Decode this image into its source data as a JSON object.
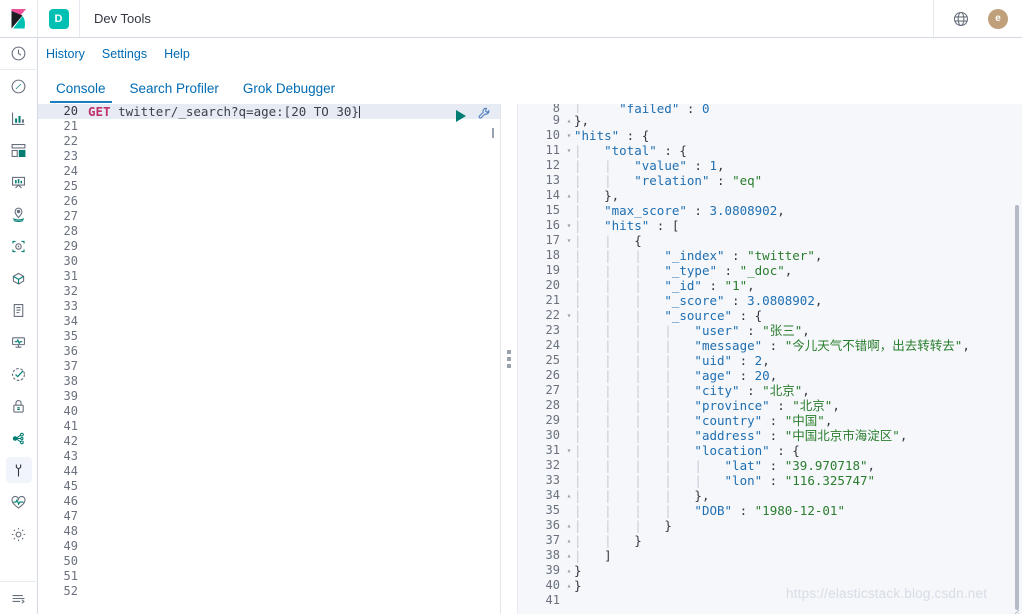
{
  "header": {
    "logo_icon": "kibana-logo-icon",
    "app_badge": "D",
    "title": "Dev Tools",
    "globe_icon": "globe-help-icon",
    "avatar_initial": "e"
  },
  "rail": {
    "items": [
      {
        "icon": "recently-viewed-clock-icon",
        "name": "recently-viewed"
      },
      {
        "icon": "discover-compass-icon",
        "name": "discover"
      },
      {
        "icon": "visualize-chart-icon",
        "name": "visualize"
      },
      {
        "icon": "dashboard-panels-icon",
        "name": "dashboard"
      },
      {
        "icon": "canvas-easel-icon",
        "name": "canvas"
      },
      {
        "icon": "maps-pin-icon",
        "name": "maps"
      },
      {
        "icon": "machine-learning-nodes-icon",
        "name": "machine-learning"
      },
      {
        "icon": "infrastructure-cube-icon",
        "name": "infrastructure"
      },
      {
        "icon": "logs-scroll-icon",
        "name": "logs"
      },
      {
        "icon": "apm-monitor-icon",
        "name": "apm"
      },
      {
        "icon": "uptime-check-icon",
        "name": "uptime"
      },
      {
        "icon": "siem-lock-icon",
        "name": "siem"
      },
      {
        "icon": "graph-network-icon",
        "name": "graph"
      },
      {
        "icon": "dev-tools-wrench-icon",
        "name": "dev-tools",
        "active": true
      },
      {
        "icon": "monitoring-heartbeat-icon",
        "name": "monitoring"
      },
      {
        "icon": "management-gear-icon",
        "name": "management"
      },
      {
        "icon": "collapse-nav-icon",
        "name": "collapse-nav"
      }
    ]
  },
  "subnav": {
    "links": [
      {
        "label": "History",
        "name": "history-link"
      },
      {
        "label": "Settings",
        "name": "settings-link"
      },
      {
        "label": "Help",
        "name": "help-link"
      }
    ]
  },
  "tabs": [
    {
      "label": "Console",
      "name": "tab-console",
      "active": true
    },
    {
      "label": "Search Profiler",
      "name": "tab-search-profiler",
      "active": false
    },
    {
      "label": "Grok Debugger",
      "name": "tab-grok-debugger",
      "active": false
    }
  ],
  "editor": {
    "first_line_number": 20,
    "last_line_number": 52,
    "method": "GET",
    "path": "twitter/_search?q=age:[20 TO 30}",
    "run_icon": "play-run-icon",
    "wrench_icon": "wrench-icon"
  },
  "response": {
    "lines": [
      {
        "n": "8",
        "fold": "",
        "text": "|     \"failed\" : 0",
        "partial": true
      },
      {
        "n": "9",
        "fold": "▴",
        "text": "},"
      },
      {
        "n": "10",
        "fold": "▾",
        "text": "\"hits\" : {"
      },
      {
        "n": "11",
        "fold": "▾",
        "text": "|   \"total\" : {"
      },
      {
        "n": "12",
        "fold": "",
        "text": "|   |   \"value\" : 1,"
      },
      {
        "n": "13",
        "fold": "",
        "text": "|   |   \"relation\" : \"eq\""
      },
      {
        "n": "14",
        "fold": "▴",
        "text": "|   },"
      },
      {
        "n": "15",
        "fold": "",
        "text": "|   \"max_score\" : 3.0808902,"
      },
      {
        "n": "16",
        "fold": "▾",
        "text": "|   \"hits\" : ["
      },
      {
        "n": "17",
        "fold": "▾",
        "text": "|   |   {"
      },
      {
        "n": "18",
        "fold": "",
        "text": "|   |   |   \"_index\" : \"twitter\","
      },
      {
        "n": "19",
        "fold": "",
        "text": "|   |   |   \"_type\" : \"_doc\","
      },
      {
        "n": "20",
        "fold": "",
        "text": "|   |   |   \"_id\" : \"1\","
      },
      {
        "n": "21",
        "fold": "",
        "text": "|   |   |   \"_score\" : 3.0808902,"
      },
      {
        "n": "22",
        "fold": "▾",
        "text": "|   |   |   \"_source\" : {"
      },
      {
        "n": "23",
        "fold": "",
        "text": "|   |   |   |   \"user\" : \"张三\","
      },
      {
        "n": "24",
        "fold": "",
        "text": "|   |   |   |   \"message\" : \"今儿天气不错啊，出去转转去\","
      },
      {
        "n": "25",
        "fold": "",
        "text": "|   |   |   |   \"uid\" : 2,"
      },
      {
        "n": "26",
        "fold": "",
        "text": "|   |   |   |   \"age\" : 20,"
      },
      {
        "n": "27",
        "fold": "",
        "text": "|   |   |   |   \"city\" : \"北京\","
      },
      {
        "n": "28",
        "fold": "",
        "text": "|   |   |   |   \"province\" : \"北京\","
      },
      {
        "n": "29",
        "fold": "",
        "text": "|   |   |   |   \"country\" : \"中国\","
      },
      {
        "n": "30",
        "fold": "",
        "text": "|   |   |   |   \"address\" : \"中国北京市海淀区\","
      },
      {
        "n": "31",
        "fold": "▾",
        "text": "|   |   |   |   \"location\" : {"
      },
      {
        "n": "32",
        "fold": "",
        "text": "|   |   |   |   |   \"lat\" : \"39.970718\","
      },
      {
        "n": "33",
        "fold": "",
        "text": "|   |   |   |   |   \"lon\" : \"116.325747\""
      },
      {
        "n": "34",
        "fold": "▴",
        "text": "|   |   |   |   },"
      },
      {
        "n": "35",
        "fold": "",
        "text": "|   |   |   |   \"DOB\" : \"1980-12-01\""
      },
      {
        "n": "36",
        "fold": "▴",
        "text": "|   |   |   }"
      },
      {
        "n": "37",
        "fold": "▴",
        "text": "|   |   }"
      },
      {
        "n": "38",
        "fold": "▴",
        "text": "|   ]"
      },
      {
        "n": "39",
        "fold": "▴",
        "text": "}"
      },
      {
        "n": "40",
        "fold": "▴",
        "text": "}"
      },
      {
        "n": "41",
        "fold": "",
        "text": ""
      }
    ]
  },
  "watermark": "https://elasticstack.blog.csdn.net",
  "colors": {
    "accent_blue": "#006bb4",
    "teal": "#00bfb3",
    "pink": "#f04e98",
    "method_pink": "#c0326a",
    "json_key": "#1f6fb2",
    "json_string": "#2a7d2e",
    "run_green": "#017d73",
    "avatar_tan": "#bfa07a"
  }
}
